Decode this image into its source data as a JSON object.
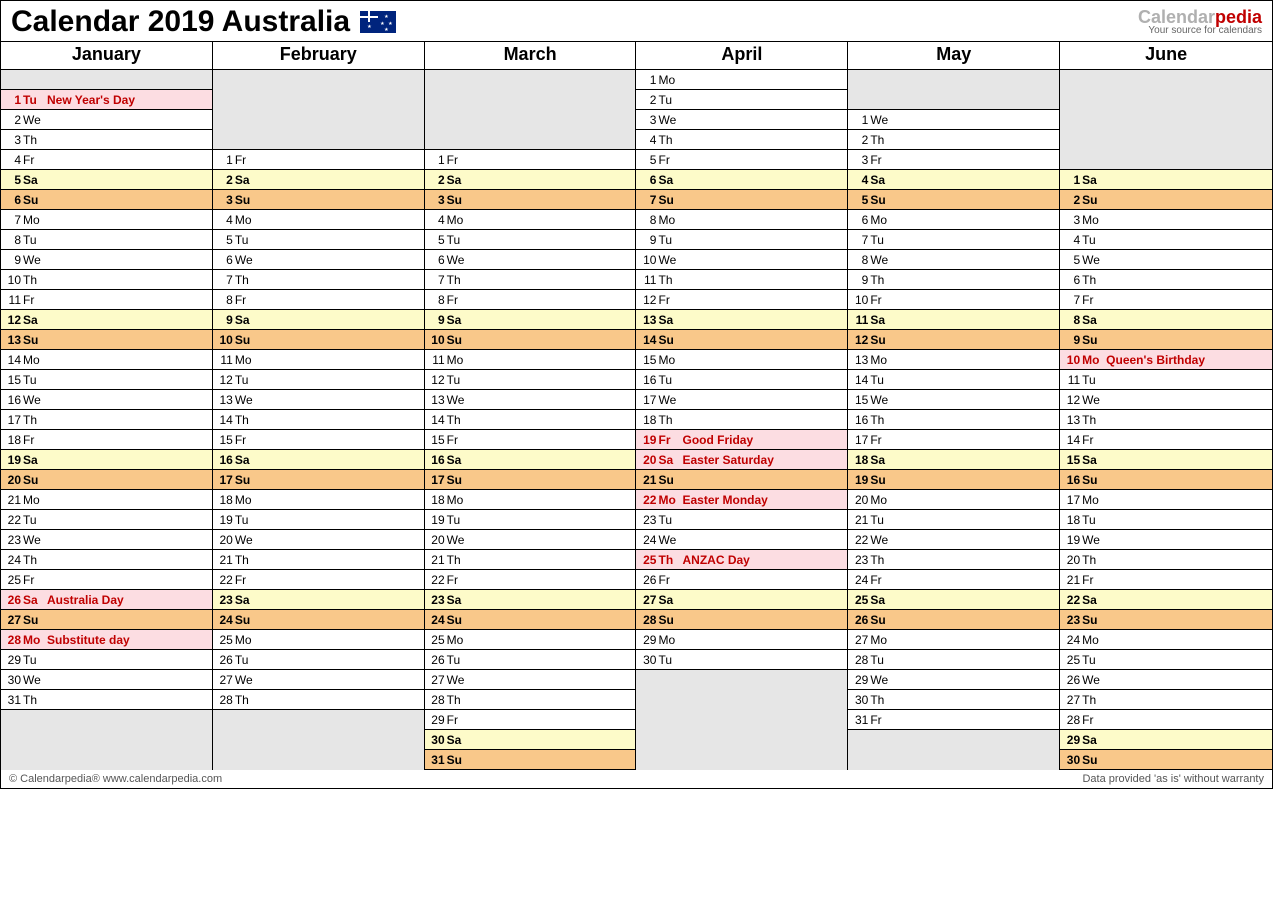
{
  "title": "Calendar 2019 Australia",
  "brand": {
    "part1": "Calendar",
    "part2": "pedia",
    "tagline": "Your source for calendars"
  },
  "footer": {
    "left": "© Calendarpedia®   www.calendarpedia.com",
    "right": "Data provided 'as is' without warranty"
  },
  "rowsPerMonth": 36,
  "months": [
    {
      "name": "January",
      "leadingBlanks": 1,
      "days": [
        {
          "n": 1,
          "d": "Tu",
          "t": "hol",
          "e": "New Year's Day"
        },
        {
          "n": 2,
          "d": "We"
        },
        {
          "n": 3,
          "d": "Th"
        },
        {
          "n": 4,
          "d": "Fr"
        },
        {
          "n": 5,
          "d": "Sa",
          "t": "sat"
        },
        {
          "n": 6,
          "d": "Su",
          "t": "sun"
        },
        {
          "n": 7,
          "d": "Mo"
        },
        {
          "n": 8,
          "d": "Tu"
        },
        {
          "n": 9,
          "d": "We"
        },
        {
          "n": 10,
          "d": "Th"
        },
        {
          "n": 11,
          "d": "Fr"
        },
        {
          "n": 12,
          "d": "Sa",
          "t": "sat"
        },
        {
          "n": 13,
          "d": "Su",
          "t": "sun"
        },
        {
          "n": 14,
          "d": "Mo"
        },
        {
          "n": 15,
          "d": "Tu"
        },
        {
          "n": 16,
          "d": "We"
        },
        {
          "n": 17,
          "d": "Th"
        },
        {
          "n": 18,
          "d": "Fr"
        },
        {
          "n": 19,
          "d": "Sa",
          "t": "sat"
        },
        {
          "n": 20,
          "d": "Su",
          "t": "sun"
        },
        {
          "n": 21,
          "d": "Mo"
        },
        {
          "n": 22,
          "d": "Tu"
        },
        {
          "n": 23,
          "d": "We"
        },
        {
          "n": 24,
          "d": "Th"
        },
        {
          "n": 25,
          "d": "Fr"
        },
        {
          "n": 26,
          "d": "Sa",
          "t": "hol",
          "e": "Australia Day"
        },
        {
          "n": 27,
          "d": "Su",
          "t": "sun"
        },
        {
          "n": 28,
          "d": "Mo",
          "t": "hol",
          "e": "Substitute day"
        },
        {
          "n": 29,
          "d": "Tu"
        },
        {
          "n": 30,
          "d": "We"
        },
        {
          "n": 31,
          "d": "Th"
        }
      ]
    },
    {
      "name": "February",
      "leadingBlanks": 4,
      "days": [
        {
          "n": 1,
          "d": "Fr"
        },
        {
          "n": 2,
          "d": "Sa",
          "t": "sat"
        },
        {
          "n": 3,
          "d": "Su",
          "t": "sun"
        },
        {
          "n": 4,
          "d": "Mo"
        },
        {
          "n": 5,
          "d": "Tu"
        },
        {
          "n": 6,
          "d": "We"
        },
        {
          "n": 7,
          "d": "Th"
        },
        {
          "n": 8,
          "d": "Fr"
        },
        {
          "n": 9,
          "d": "Sa",
          "t": "sat"
        },
        {
          "n": 10,
          "d": "Su",
          "t": "sun"
        },
        {
          "n": 11,
          "d": "Mo"
        },
        {
          "n": 12,
          "d": "Tu"
        },
        {
          "n": 13,
          "d": "We"
        },
        {
          "n": 14,
          "d": "Th"
        },
        {
          "n": 15,
          "d": "Fr"
        },
        {
          "n": 16,
          "d": "Sa",
          "t": "sat"
        },
        {
          "n": 17,
          "d": "Su",
          "t": "sun"
        },
        {
          "n": 18,
          "d": "Mo"
        },
        {
          "n": 19,
          "d": "Tu"
        },
        {
          "n": 20,
          "d": "We"
        },
        {
          "n": 21,
          "d": "Th"
        },
        {
          "n": 22,
          "d": "Fr"
        },
        {
          "n": 23,
          "d": "Sa",
          "t": "sat"
        },
        {
          "n": 24,
          "d": "Su",
          "t": "sun"
        },
        {
          "n": 25,
          "d": "Mo"
        },
        {
          "n": 26,
          "d": "Tu"
        },
        {
          "n": 27,
          "d": "We"
        },
        {
          "n": 28,
          "d": "Th"
        }
      ]
    },
    {
      "name": "March",
      "leadingBlanks": 4,
      "days": [
        {
          "n": 1,
          "d": "Fr"
        },
        {
          "n": 2,
          "d": "Sa",
          "t": "sat"
        },
        {
          "n": 3,
          "d": "Su",
          "t": "sun"
        },
        {
          "n": 4,
          "d": "Mo"
        },
        {
          "n": 5,
          "d": "Tu"
        },
        {
          "n": 6,
          "d": "We"
        },
        {
          "n": 7,
          "d": "Th"
        },
        {
          "n": 8,
          "d": "Fr"
        },
        {
          "n": 9,
          "d": "Sa",
          "t": "sat"
        },
        {
          "n": 10,
          "d": "Su",
          "t": "sun"
        },
        {
          "n": 11,
          "d": "Mo"
        },
        {
          "n": 12,
          "d": "Tu"
        },
        {
          "n": 13,
          "d": "We"
        },
        {
          "n": 14,
          "d": "Th"
        },
        {
          "n": 15,
          "d": "Fr"
        },
        {
          "n": 16,
          "d": "Sa",
          "t": "sat"
        },
        {
          "n": 17,
          "d": "Su",
          "t": "sun"
        },
        {
          "n": 18,
          "d": "Mo"
        },
        {
          "n": 19,
          "d": "Tu"
        },
        {
          "n": 20,
          "d": "We"
        },
        {
          "n": 21,
          "d": "Th"
        },
        {
          "n": 22,
          "d": "Fr"
        },
        {
          "n": 23,
          "d": "Sa",
          "t": "sat"
        },
        {
          "n": 24,
          "d": "Su",
          "t": "sun"
        },
        {
          "n": 25,
          "d": "Mo"
        },
        {
          "n": 26,
          "d": "Tu"
        },
        {
          "n": 27,
          "d": "We"
        },
        {
          "n": 28,
          "d": "Th"
        },
        {
          "n": 29,
          "d": "Fr"
        },
        {
          "n": 30,
          "d": "Sa",
          "t": "sat"
        },
        {
          "n": 31,
          "d": "Su",
          "t": "sun"
        }
      ]
    },
    {
      "name": "April",
      "leadingBlanks": 0,
      "days": [
        {
          "n": 1,
          "d": "Mo"
        },
        {
          "n": 2,
          "d": "Tu"
        },
        {
          "n": 3,
          "d": "We"
        },
        {
          "n": 4,
          "d": "Th"
        },
        {
          "n": 5,
          "d": "Fr"
        },
        {
          "n": 6,
          "d": "Sa",
          "t": "sat"
        },
        {
          "n": 7,
          "d": "Su",
          "t": "sun"
        },
        {
          "n": 8,
          "d": "Mo"
        },
        {
          "n": 9,
          "d": "Tu"
        },
        {
          "n": 10,
          "d": "We"
        },
        {
          "n": 11,
          "d": "Th"
        },
        {
          "n": 12,
          "d": "Fr"
        },
        {
          "n": 13,
          "d": "Sa",
          "t": "sat"
        },
        {
          "n": 14,
          "d": "Su",
          "t": "sun"
        },
        {
          "n": 15,
          "d": "Mo"
        },
        {
          "n": 16,
          "d": "Tu"
        },
        {
          "n": 17,
          "d": "We"
        },
        {
          "n": 18,
          "d": "Th"
        },
        {
          "n": 19,
          "d": "Fr",
          "t": "hol",
          "e": "Good Friday"
        },
        {
          "n": 20,
          "d": "Sa",
          "t": "hol",
          "e": "Easter Saturday"
        },
        {
          "n": 21,
          "d": "Su",
          "t": "sun"
        },
        {
          "n": 22,
          "d": "Mo",
          "t": "hol",
          "e": "Easter Monday"
        },
        {
          "n": 23,
          "d": "Tu"
        },
        {
          "n": 24,
          "d": "We"
        },
        {
          "n": 25,
          "d": "Th",
          "t": "hol",
          "e": "ANZAC Day"
        },
        {
          "n": 26,
          "d": "Fr"
        },
        {
          "n": 27,
          "d": "Sa",
          "t": "sat"
        },
        {
          "n": 28,
          "d": "Su",
          "t": "sun"
        },
        {
          "n": 29,
          "d": "Mo"
        },
        {
          "n": 30,
          "d": "Tu"
        }
      ]
    },
    {
      "name": "May",
      "leadingBlanks": 2,
      "days": [
        {
          "n": 1,
          "d": "We"
        },
        {
          "n": 2,
          "d": "Th"
        },
        {
          "n": 3,
          "d": "Fr"
        },
        {
          "n": 4,
          "d": "Sa",
          "t": "sat"
        },
        {
          "n": 5,
          "d": "Su",
          "t": "sun"
        },
        {
          "n": 6,
          "d": "Mo"
        },
        {
          "n": 7,
          "d": "Tu"
        },
        {
          "n": 8,
          "d": "We"
        },
        {
          "n": 9,
          "d": "Th"
        },
        {
          "n": 10,
          "d": "Fr"
        },
        {
          "n": 11,
          "d": "Sa",
          "t": "sat"
        },
        {
          "n": 12,
          "d": "Su",
          "t": "sun"
        },
        {
          "n": 13,
          "d": "Mo"
        },
        {
          "n": 14,
          "d": "Tu"
        },
        {
          "n": 15,
          "d": "We"
        },
        {
          "n": 16,
          "d": "Th"
        },
        {
          "n": 17,
          "d": "Fr"
        },
        {
          "n": 18,
          "d": "Sa",
          "t": "sat"
        },
        {
          "n": 19,
          "d": "Su",
          "t": "sun"
        },
        {
          "n": 20,
          "d": "Mo"
        },
        {
          "n": 21,
          "d": "Tu"
        },
        {
          "n": 22,
          "d": "We"
        },
        {
          "n": 23,
          "d": "Th"
        },
        {
          "n": 24,
          "d": "Fr"
        },
        {
          "n": 25,
          "d": "Sa",
          "t": "sat"
        },
        {
          "n": 26,
          "d": "Su",
          "t": "sun"
        },
        {
          "n": 27,
          "d": "Mo"
        },
        {
          "n": 28,
          "d": "Tu"
        },
        {
          "n": 29,
          "d": "We"
        },
        {
          "n": 30,
          "d": "Th"
        },
        {
          "n": 31,
          "d": "Fr"
        }
      ]
    },
    {
      "name": "June",
      "leadingBlanks": 5,
      "days": [
        {
          "n": 1,
          "d": "Sa",
          "t": "sat"
        },
        {
          "n": 2,
          "d": "Su",
          "t": "sun"
        },
        {
          "n": 3,
          "d": "Mo"
        },
        {
          "n": 4,
          "d": "Tu"
        },
        {
          "n": 5,
          "d": "We"
        },
        {
          "n": 6,
          "d": "Th"
        },
        {
          "n": 7,
          "d": "Fr"
        },
        {
          "n": 8,
          "d": "Sa",
          "t": "sat"
        },
        {
          "n": 9,
          "d": "Su",
          "t": "sun"
        },
        {
          "n": 10,
          "d": "Mo",
          "t": "hol",
          "e": "Queen's Birthday"
        },
        {
          "n": 11,
          "d": "Tu"
        },
        {
          "n": 12,
          "d": "We"
        },
        {
          "n": 13,
          "d": "Th"
        },
        {
          "n": 14,
          "d": "Fr"
        },
        {
          "n": 15,
          "d": "Sa",
          "t": "sat"
        },
        {
          "n": 16,
          "d": "Su",
          "t": "sun"
        },
        {
          "n": 17,
          "d": "Mo"
        },
        {
          "n": 18,
          "d": "Tu"
        },
        {
          "n": 19,
          "d": "We"
        },
        {
          "n": 20,
          "d": "Th"
        },
        {
          "n": 21,
          "d": "Fr"
        },
        {
          "n": 22,
          "d": "Sa",
          "t": "sat"
        },
        {
          "n": 23,
          "d": "Su",
          "t": "sun"
        },
        {
          "n": 24,
          "d": "Mo"
        },
        {
          "n": 25,
          "d": "Tu"
        },
        {
          "n": 26,
          "d": "We"
        },
        {
          "n": 27,
          "d": "Th"
        },
        {
          "n": 28,
          "d": "Fr"
        },
        {
          "n": 29,
          "d": "Sa",
          "t": "sat"
        },
        {
          "n": 30,
          "d": "Su",
          "t": "sun"
        }
      ]
    }
  ]
}
